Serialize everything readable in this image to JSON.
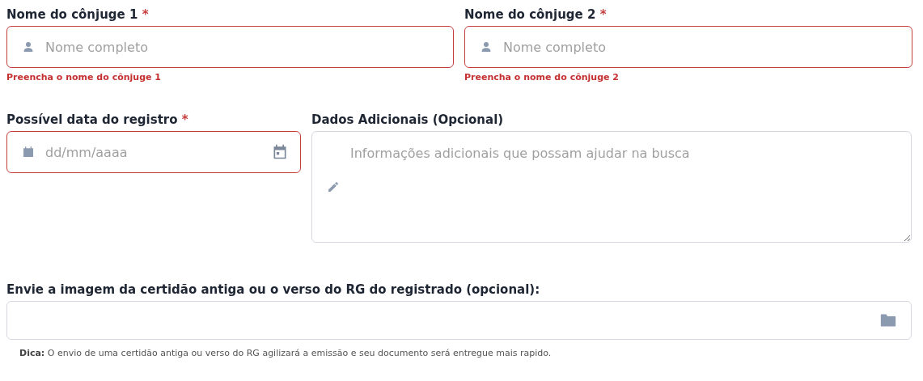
{
  "fields": [
    {
      "kind": "text",
      "label": "Nome do cônjuge 1",
      "required_mark": "*",
      "placeholder": "Nome completo",
      "invalid": true,
      "error": "Preencha o nome do cônjuge 1"
    },
    {
      "kind": "text",
      "label": "Nome do cônjuge 2",
      "required_mark": "*",
      "placeholder": "Nome completo",
      "invalid": true,
      "error": "Preencha o nome do cônjuge 2"
    },
    {
      "kind": "date",
      "label": "Possível data do registro",
      "required_mark": "*",
      "placeholder": "dd/mm/aaaa",
      "invalid": true
    },
    {
      "kind": "textarea",
      "label": "Dados Adicionais (Opcional)",
      "placeholder": "Informações adicionais que possam ajudar na busca",
      "invalid": false
    },
    {
      "kind": "file",
      "label": "Envie a imagem da certidão antiga ou o verso do RG do registrado (opcional):",
      "invalid": false,
      "tip": "**Dica:** O envio de uma certidão antiga ou verso do RG agilizará a emissão e seu documento será entregue mais rapido."
    }
  ]
}
